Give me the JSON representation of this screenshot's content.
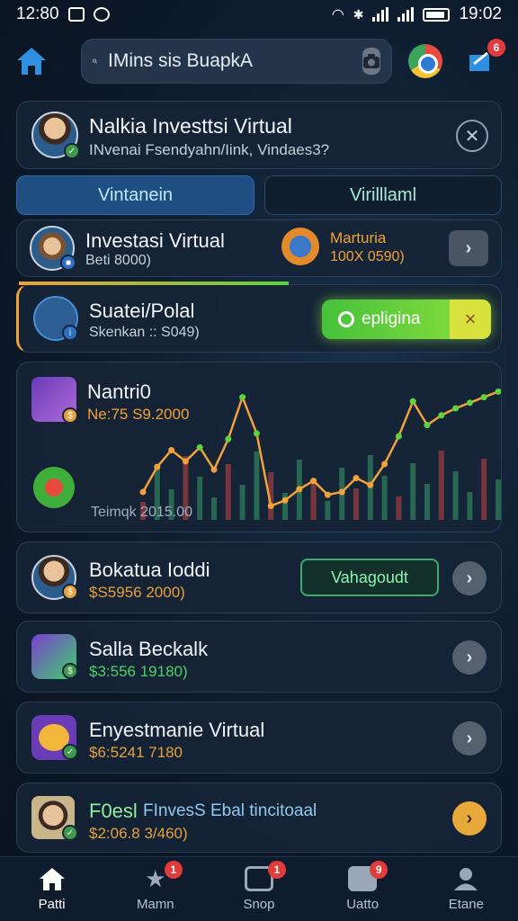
{
  "status_bar": {
    "time_left": "12:80",
    "time_right": "19:02"
  },
  "search": {
    "value": "IMins sis BuapkA"
  },
  "header_card": {
    "title": "Nalkia Investtsi Virtual",
    "subtitle": "INvenai Fsendyahn/Iink, Vindaes3?"
  },
  "tabs": [
    {
      "label": "Vintanein",
      "active": true
    },
    {
      "label": "Virilllaml",
      "active": false
    }
  ],
  "item_investasi": {
    "title": "Investasi Virtual",
    "sub": "Beti 8000)",
    "right_title": "Marturia",
    "right_sub": "100X 0590)"
  },
  "item_suatei": {
    "title": "Suatei/Polal",
    "sub": "Skenkan  :: S049)",
    "action_label": "epligina",
    "close_symbol": "×"
  },
  "chart_card": {
    "title": "Nantri0",
    "sub": "Ne:75 S9.2000",
    "caption": "Teimqk 2015.00",
    "chart_data": {
      "type": "line",
      "series": [
        {
          "values": [
            20,
            38,
            50,
            42,
            52,
            36,
            58,
            88,
            62,
            10,
            14,
            22,
            28,
            18,
            20,
            30,
            25,
            40,
            60,
            85,
            68,
            75,
            80,
            84,
            88,
            92
          ]
        }
      ],
      "ylim": [
        0,
        100
      ]
    }
  },
  "item_bokatua": {
    "title": "Bokatua Ioddi",
    "sub": "$S5956 2000)",
    "action_label": "Vahagoudt"
  },
  "item_salla": {
    "title": "Salla Beckalk",
    "sub": "$3:556 19180)"
  },
  "item_enyest": {
    "title": "Enyestmanie Virtual",
    "sub": "$6:5241 7180"
  },
  "item_foesl": {
    "title_a": "F0esl",
    "title_b": "FInvesS Ebal tincitoaal",
    "sub": "$2:06.8 3/460)"
  },
  "nav": [
    {
      "label": "Patti",
      "badge": ""
    },
    {
      "label": "Mamn",
      "badge": "1"
    },
    {
      "label": "Snop",
      "badge": "1"
    },
    {
      "label": "Uatto",
      "badge": "9"
    },
    {
      "label": "Etane",
      "badge": ""
    }
  ],
  "colors": {
    "accent_blue": "#2f8fe0",
    "accent_green": "#5dd43e",
    "accent_orange": "#f2a23a",
    "price_green": "#4fd16a",
    "price_orange": "#e8a23d"
  }
}
